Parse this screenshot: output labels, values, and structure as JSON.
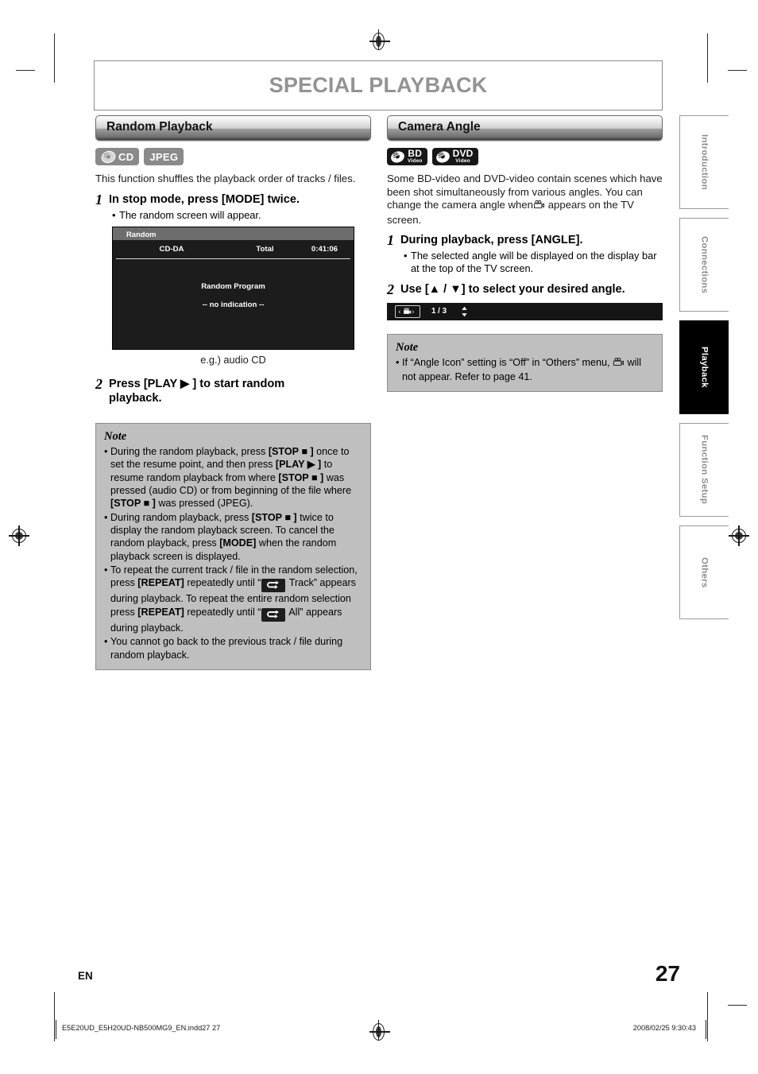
{
  "page": {
    "title": "SPECIAL PLAYBACK",
    "language_mark": "EN",
    "page_number": "27"
  },
  "left_column": {
    "section_title": "Random Playback",
    "badges": [
      {
        "kind": "disc",
        "label": "CD",
        "style": "grey"
      },
      {
        "kind": "text",
        "label": "JPEG",
        "style": "grey"
      }
    ],
    "intro": "This function shuffles the playback order of tracks / files.",
    "steps": [
      {
        "num": "1",
        "text": "In stop mode, press [MODE] twice.",
        "sub": "The random screen will appear."
      },
      {
        "num": "2",
        "text": "Press [PLAY ▶ ] to start random playback."
      }
    ],
    "screen": {
      "header": "Random",
      "disc_type": "CD-DA",
      "total_label": "Total",
      "total_time": "0:41:06",
      "line1": "Random Program",
      "line2": "-- no indication --"
    },
    "caption": "e.g.) audio CD",
    "note": {
      "title": "Note",
      "items": [
        "During the random playback, press [STOP ■ ] once to set the resume point, and then press [PLAY ▶ ] to resume random playback from where [STOP ■ ] was pressed (audio CD) or from beginning of the file where [STOP ■ ] was pressed (JPEG).",
        "During random playback, press [STOP ■ ] twice to display the random playback screen. To cancel the random playback, press [MODE] when the random playback screen is displayed.",
        "To repeat the current track / file in the random selection, press [REPEAT] repeatedly until “ ↺ Track” appears during playback. To repeat the entire random selection press [REPEAT] repeatedly until “ ↺ All” appears during playback.",
        "You cannot go back to the previous track / file during random playback."
      ]
    }
  },
  "right_column": {
    "section_title": "Camera Angle",
    "badges": [
      {
        "kind": "disc",
        "label": "BD",
        "sublabel": "Video",
        "style": "black"
      },
      {
        "kind": "disc",
        "label": "DVD",
        "sublabel": "Video",
        "style": "black"
      }
    ],
    "intro": "Some BD-video and DVD-video contain scenes which have been shot simultaneously from various angles. You can change the camera angle when",
    "intro_tail": "appears on the TV screen.",
    "steps": [
      {
        "num": "1",
        "text": "During playback, press [ANGLE].",
        "sub": "The selected angle will be displayed on the display bar at the top of the TV screen."
      },
      {
        "num": "2",
        "text": "Use [▲ / ▼] to select your desired angle."
      }
    ],
    "angle_bar": {
      "icon": "camera-angle-icon",
      "count": "1 / 3",
      "updown": "↕"
    },
    "note": {
      "title": "Note",
      "item_head": "If “Angle Icon” setting is “Off” in “Others” menu,",
      "item_tail": "will not appear. Refer to page 41."
    }
  },
  "side_tabs": [
    {
      "label": "Introduction",
      "active": false
    },
    {
      "label": "Connections",
      "active": false
    },
    {
      "label": "Playback",
      "active": true
    },
    {
      "label": "Function Setup",
      "active": false
    },
    {
      "label": "Others",
      "active": false
    }
  ],
  "imprint": {
    "left": "E5E20UD_E5H20UD-NB500MG9_EN.indd27   27",
    "right": "2008/02/25   9:30:43"
  },
  "colors": {
    "title_grey": "#939393",
    "note_bg": "#bfbfbf",
    "screen_bg": "#1d1c1c",
    "screen_header": "#6d6d6d",
    "tab_inactive_text": "#8d8d8d",
    "tab_active_bg": "#000000"
  }
}
